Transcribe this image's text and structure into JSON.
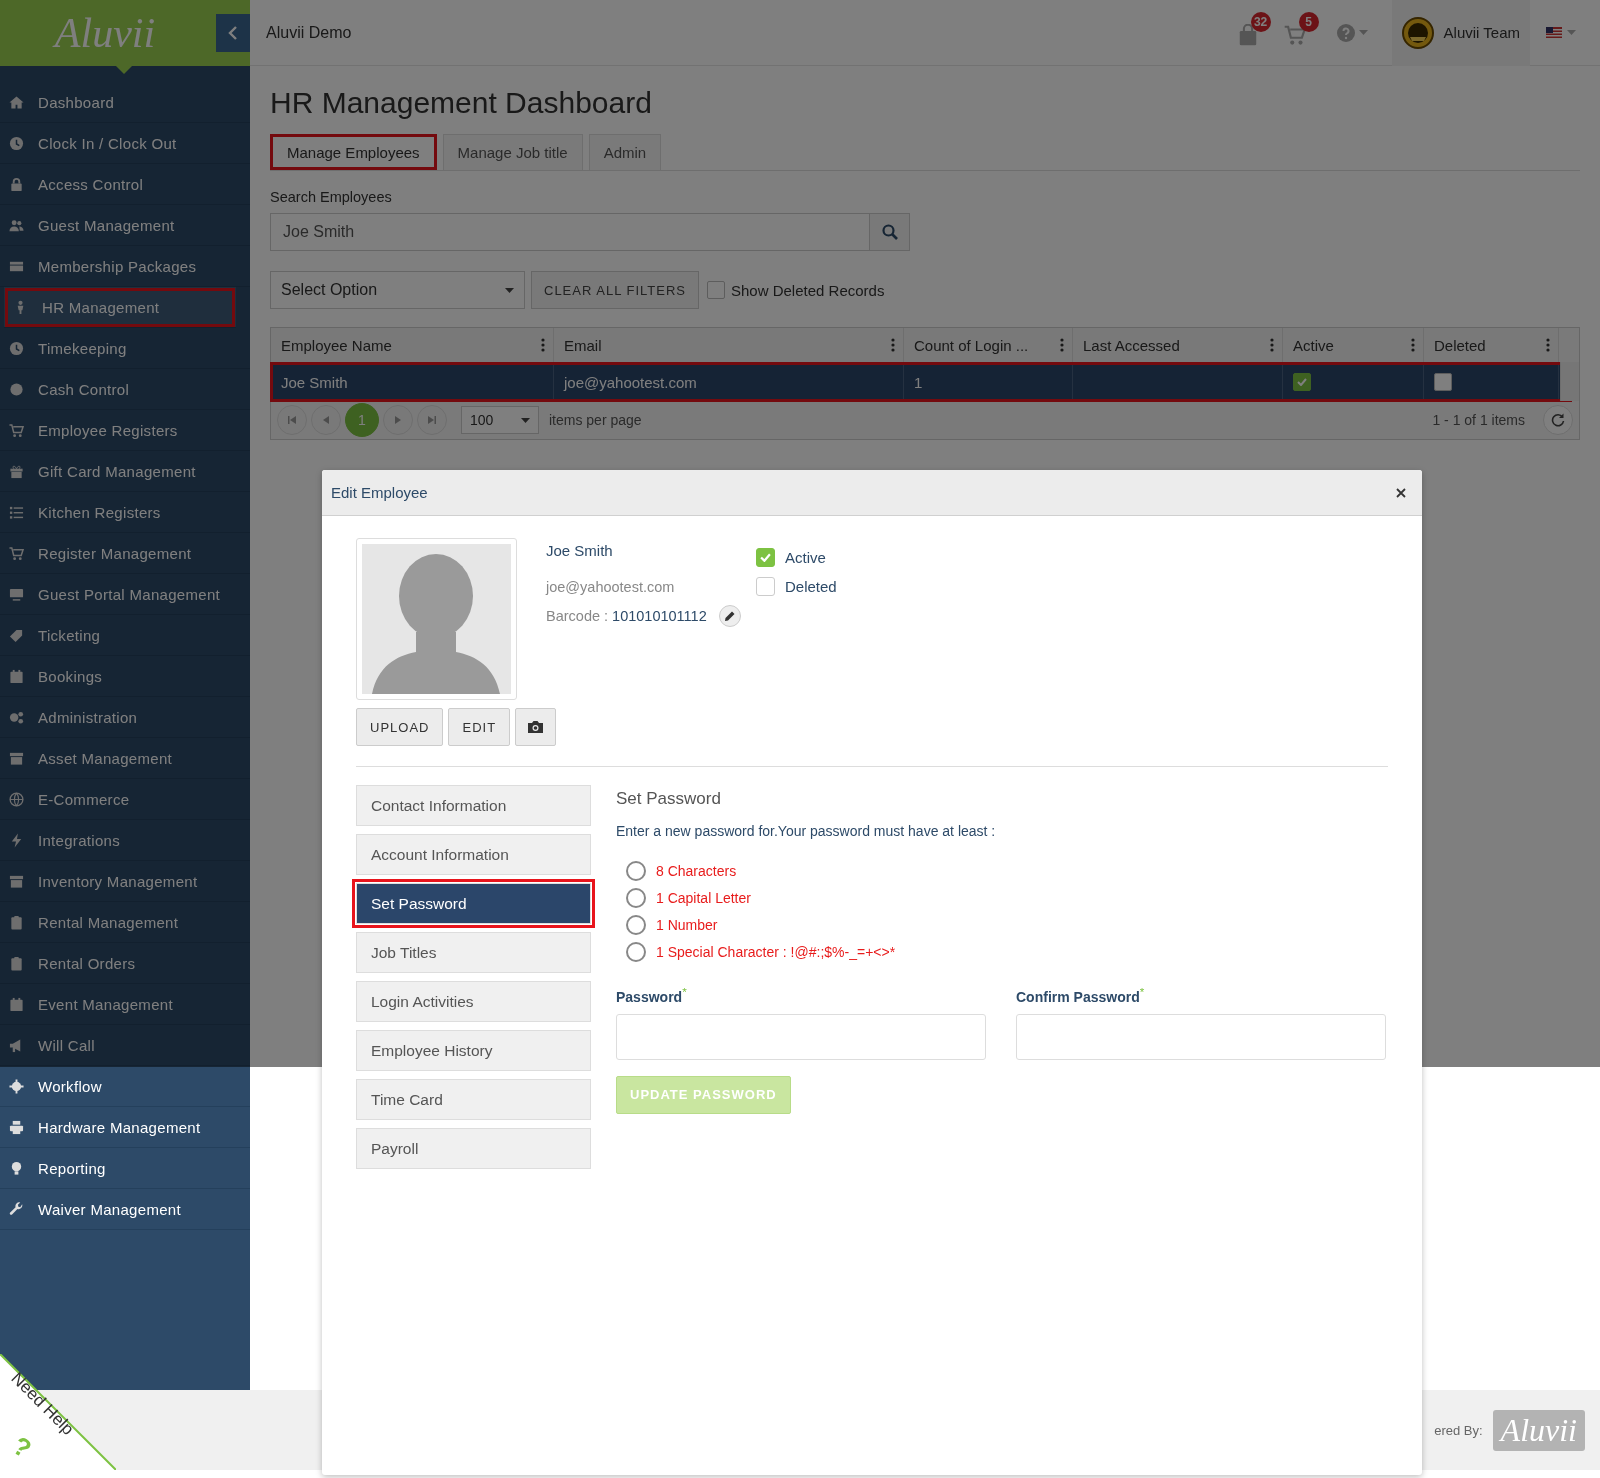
{
  "header": {
    "logo": "Aluvii",
    "site_name": "Aluvii Demo",
    "notifications": {
      "badge": "32"
    },
    "cart": {
      "badge": "5"
    },
    "user": "Aluvii Team"
  },
  "sidebar": {
    "items": [
      {
        "label": "Dashboard",
        "selected": false
      },
      {
        "label": "Clock In / Clock Out",
        "selected": false
      },
      {
        "label": "Access Control",
        "selected": false
      },
      {
        "label": "Guest Management",
        "selected": false
      },
      {
        "label": "Membership Packages",
        "selected": false
      },
      {
        "label": "HR Management",
        "selected": true
      },
      {
        "label": "Timekeeping",
        "selected": false
      },
      {
        "label": "Cash Control",
        "selected": false
      },
      {
        "label": "Employee Registers",
        "selected": false
      },
      {
        "label": "Gift Card Management",
        "selected": false
      },
      {
        "label": "Kitchen Registers",
        "selected": false
      },
      {
        "label": "Register Management",
        "selected": false
      },
      {
        "label": "Guest Portal Management",
        "selected": false
      },
      {
        "label": "Ticketing",
        "selected": false
      },
      {
        "label": "Bookings",
        "selected": false
      },
      {
        "label": "Administration",
        "selected": false
      },
      {
        "label": "Asset Management",
        "selected": false
      },
      {
        "label": "E-Commerce",
        "selected": false
      },
      {
        "label": "Integrations",
        "selected": false
      },
      {
        "label": "Inventory Management",
        "selected": false
      },
      {
        "label": "Rental Management",
        "selected": false
      },
      {
        "label": "Rental Orders",
        "selected": false
      },
      {
        "label": "Event Management",
        "selected": false
      },
      {
        "label": "Will Call",
        "selected": false
      },
      {
        "label": "Workflow",
        "selected": false
      },
      {
        "label": "Hardware Management",
        "selected": false
      },
      {
        "label": "Reporting",
        "selected": false
      },
      {
        "label": "Waiver Management",
        "selected": false
      }
    ]
  },
  "page": {
    "title": "HR Management Dashboard",
    "tabs": [
      {
        "label": "Manage Employees",
        "selected": true
      },
      {
        "label": "Manage Job title",
        "selected": false
      },
      {
        "label": "Admin",
        "selected": false
      }
    ],
    "search": {
      "label": "Search Employees",
      "value": "Joe Smith"
    },
    "filter_select": {
      "value": "Select Option"
    },
    "clear_button": "CLEAR ALL FILTERS",
    "show_deleted": {
      "label": "Show Deleted Records",
      "checked": false
    },
    "table": {
      "columns": [
        "Employee Name",
        "Email",
        "Count of Login ...",
        "Last Accessed",
        "Active",
        "Deleted"
      ],
      "rows": [
        {
          "employee_name": "Joe Smith",
          "email": "joe@yahootest.com",
          "login_count": "1",
          "active": true,
          "deleted": false,
          "selected": true
        }
      ]
    },
    "pager": {
      "page": "1",
      "page_size": "100",
      "per_page_label": "items per page",
      "summary": "1 - 1 of 1 items"
    }
  },
  "modal": {
    "title": "Edit Employee",
    "name": "Joe Smith",
    "email": "joe@yahootest.com",
    "barcode_label": "Barcode :",
    "barcode": "101010101112",
    "flags": [
      {
        "label": "Active",
        "checked": true
      },
      {
        "label": "Deleted",
        "checked": false
      }
    ],
    "photo_buttons": [
      "UPLOAD",
      "EDIT"
    ],
    "sections": [
      {
        "label": "Contact Information",
        "selected": false
      },
      {
        "label": "Account Information",
        "selected": false
      },
      {
        "label": "Set Password",
        "selected": true
      },
      {
        "label": "Job Titles",
        "selected": false
      },
      {
        "label": "Login Activities",
        "selected": false
      },
      {
        "label": "Employee History",
        "selected": false
      },
      {
        "label": "Time Card",
        "selected": false
      },
      {
        "label": "Payroll",
        "selected": false
      }
    ],
    "panel": {
      "title": "Set Password",
      "intro": "Enter a new password for.Your password must have at least :",
      "rules": [
        {
          "label": "8 Characters",
          "met": false
        },
        {
          "label": "1 Capital Letter",
          "met": false
        },
        {
          "label": "1 Number",
          "met": false
        },
        {
          "label": "1 Special Character : !@#:;$%-_=+<>*",
          "met": false
        }
      ],
      "fields": [
        {
          "label": "Password$^{*}$"
        },
        {
          "label": "Confirm Password$^{*}$"
        }
      ],
      "button": {
        "label": "UPDATE PASSWORD",
        "disabled": true
      }
    }
  },
  "footer": {
    "powered_by": "ered By:",
    "logo": "Aluvii"
  },
  "help": {
    "label": "Need Help",
    "icon_text": "?"
  }
}
